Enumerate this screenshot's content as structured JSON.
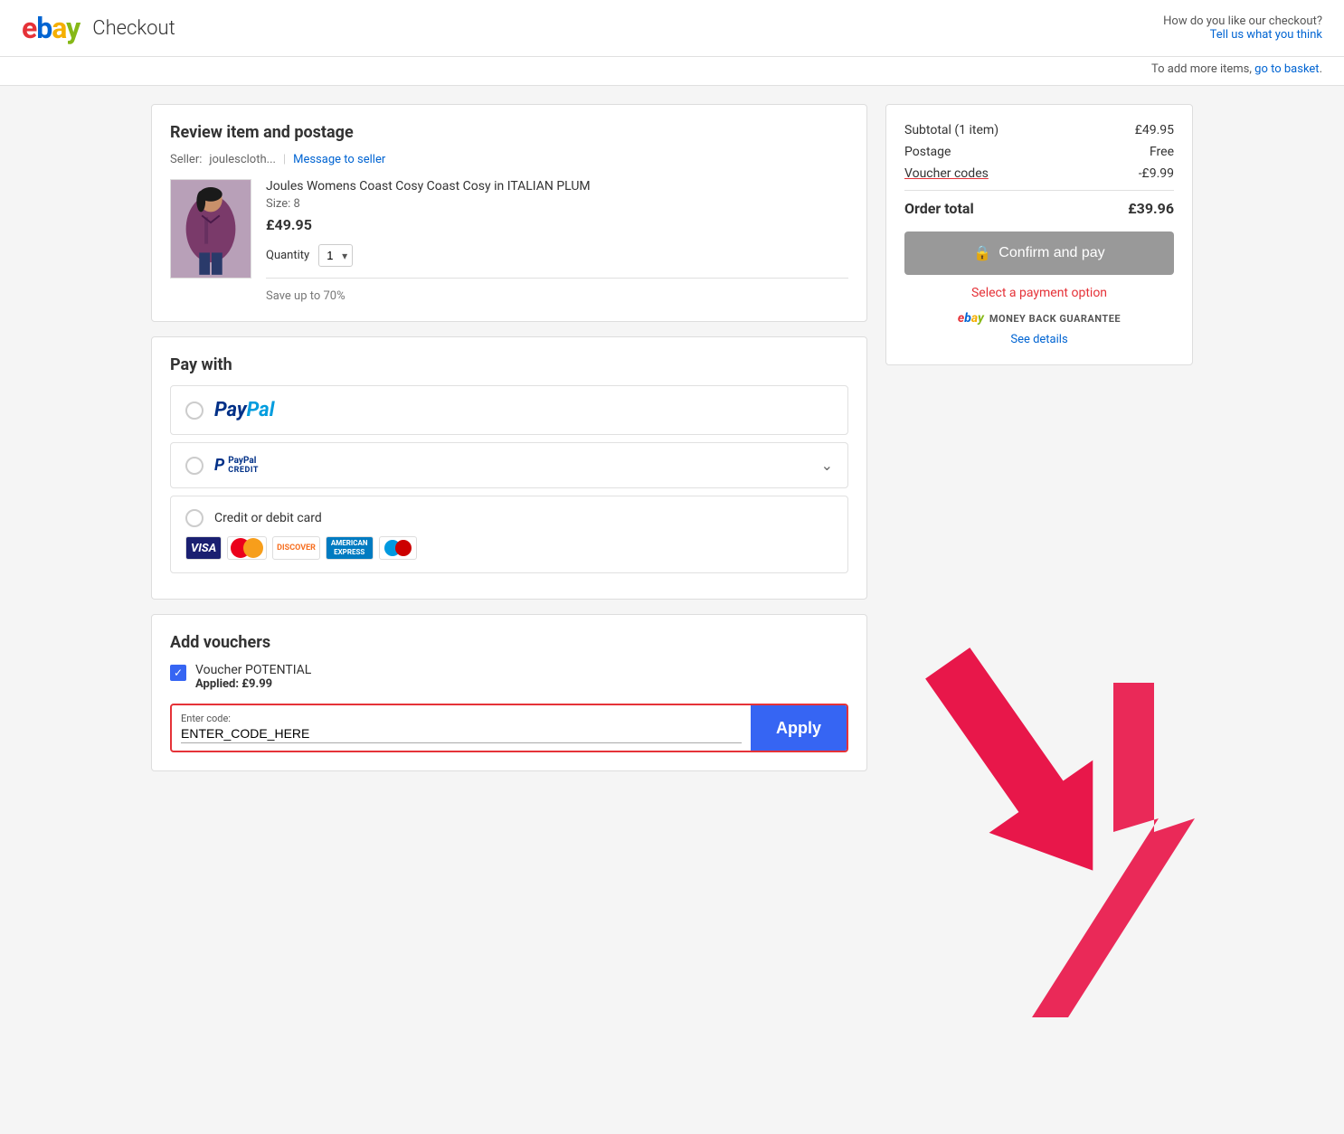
{
  "header": {
    "logo": {
      "e": "e",
      "b": "b",
      "a": "a",
      "y": "y"
    },
    "title": "Checkout",
    "feedback_prompt": "How do you like our checkout?",
    "feedback_link": "Tell us what you think",
    "basket_prompt": "To add more items,",
    "basket_link": "go to basket",
    "basket_suffix": "."
  },
  "review_section": {
    "title": "Review item and postage",
    "seller_label": "Seller:",
    "seller_name": "joulescloth...",
    "message_link": "Message to seller",
    "item_name": "Joules Womens Coast Cosy Coast Cosy in ITALIAN PLUM",
    "item_size": "Size: 8",
    "item_price": "£49.95",
    "quantity_label": "Quantity",
    "quantity_value": "1",
    "save_text": "Save up to 70%"
  },
  "pay_section": {
    "title": "Pay with",
    "options": [
      {
        "id": "paypal",
        "label": "PayPal"
      },
      {
        "id": "paypal-credit",
        "label": "PayPal Credit"
      },
      {
        "id": "card",
        "label": "Credit or debit card"
      }
    ]
  },
  "voucher_section": {
    "title": "Add vouchers",
    "voucher_name": "Voucher POTENTIAL",
    "voucher_applied": "Applied: £9.99",
    "input_label": "Enter code:",
    "input_value": "ENTER_CODE_HERE",
    "apply_button": "Apply"
  },
  "order_summary": {
    "subtotal_label": "Subtotal (1 item)",
    "subtotal_value": "£49.95",
    "postage_label": "Postage",
    "postage_value": "Free",
    "voucher_label": "Voucher codes",
    "voucher_value": "-£9.99",
    "total_label": "Order total",
    "total_value": "£39.96",
    "confirm_button": "Confirm and pay",
    "payment_required": "Select a payment option",
    "money_back_text": "MONEY BACK GUARANTEE",
    "see_details_link": "See details"
  }
}
